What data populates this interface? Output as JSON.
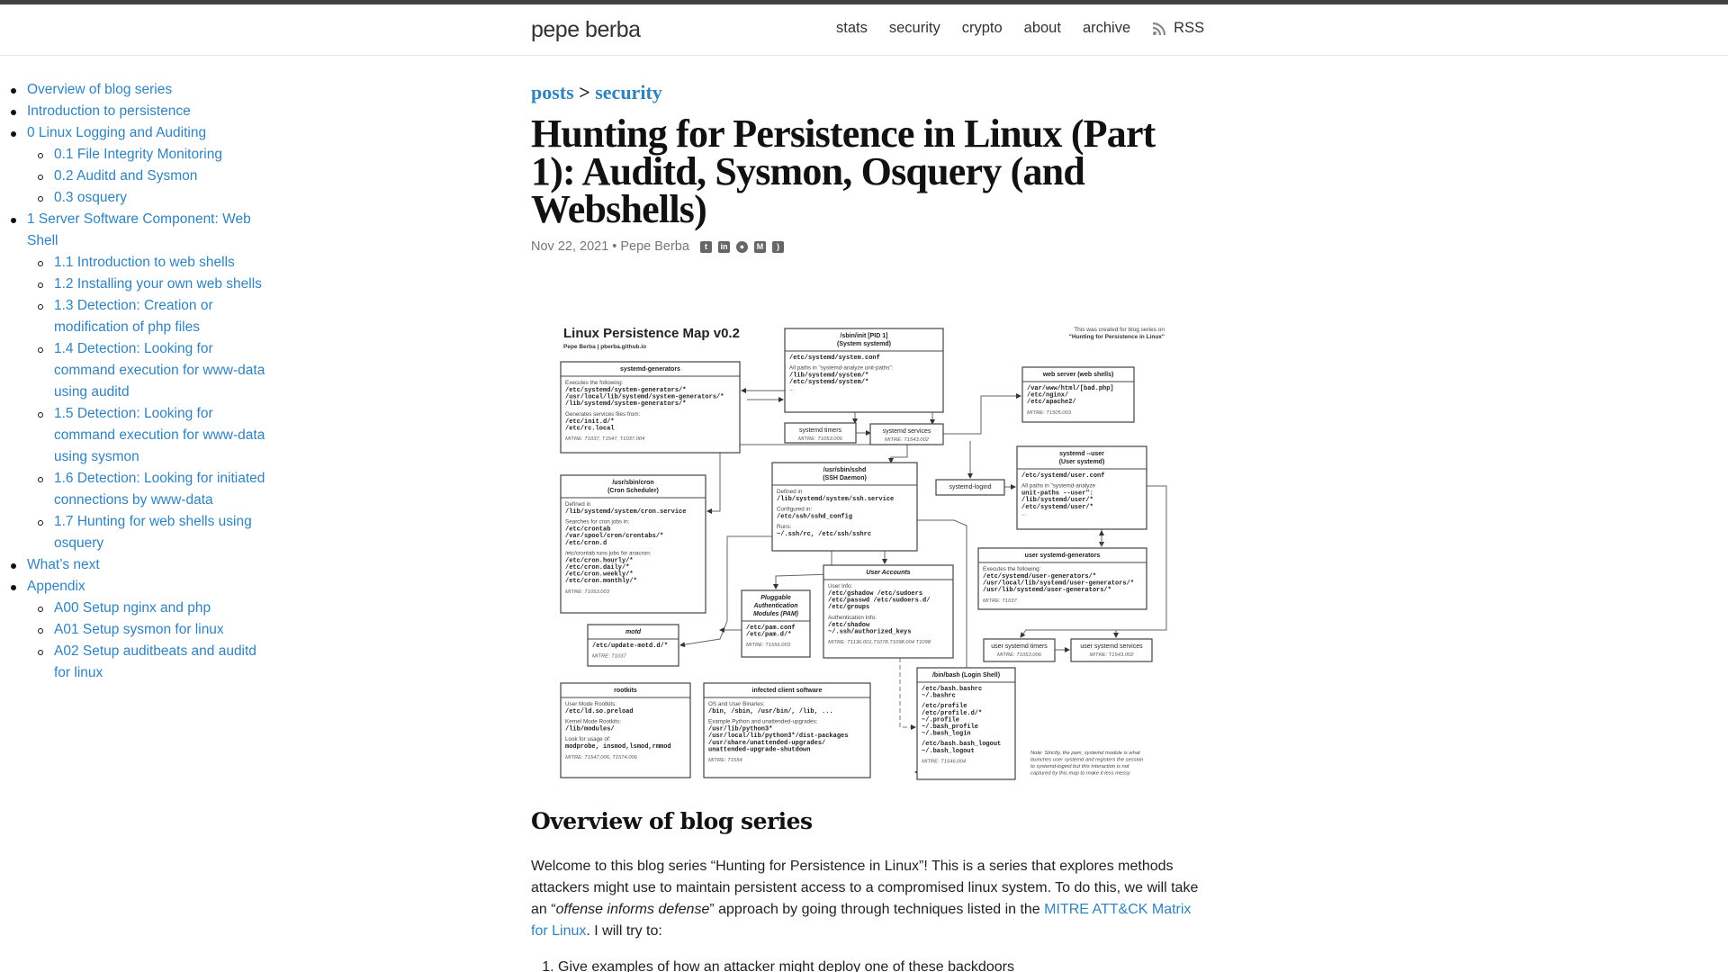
{
  "header": {
    "site_title": "pepe berba",
    "nav": [
      "stats",
      "security",
      "crypto",
      "about",
      "archive"
    ],
    "rss_label": "RSS"
  },
  "toc": [
    {
      "label": "Overview of blog series",
      "level": 0
    },
    {
      "label": "Introduction to persistence",
      "level": 0
    },
    {
      "label": "0 Linux Logging and Auditing",
      "level": 0
    },
    {
      "label": "0.1 File Integrity Monitoring",
      "level": 1
    },
    {
      "label": "0.2 Auditd and Sysmon",
      "level": 1
    },
    {
      "label": "0.3 osquery",
      "level": 1
    },
    {
      "label": "1 Server Software Component: Web Shell",
      "level": 0
    },
    {
      "label": "1.1 Introduction to web shells",
      "level": 1
    },
    {
      "label": "1.2 Installing your own web shells",
      "level": 1
    },
    {
      "label": "1.3 Detection: Creation or modification of php files",
      "level": 1
    },
    {
      "label": "1.4 Detection: Looking for command execution for www-data using auditd",
      "level": 1
    },
    {
      "label": "1.5 Detection: Looking for command execution for www-data using sysmon",
      "level": 1
    },
    {
      "label": "1.6 Detection: Looking for initiated connections by www-data",
      "level": 1
    },
    {
      "label": "1.7 Hunting for web shells using osquery",
      "level": 1
    },
    {
      "label": "What’s next",
      "level": 0
    },
    {
      "label": "Appendix",
      "level": 0
    },
    {
      "label": "A00 Setup nginx and php",
      "level": 1
    },
    {
      "label": "A01 Setup sysmon for linux",
      "level": 1
    },
    {
      "label": "A02 Setup auditbeats and auditd for linux",
      "level": 1
    }
  ],
  "post": {
    "breadcrumb": {
      "root": "posts",
      "sep": ">",
      "category": "security"
    },
    "title": "Hunting for Persistence in Linux (Part 1): Auditd, Sysmon, Osquery (and Webshells)",
    "date": "Nov 22, 2021",
    "dot": "•",
    "author": "Pepe Berba",
    "share_icons": [
      "twitter-icon",
      "linkedin-icon",
      "github-icon",
      "medium-icon",
      "rss-icon"
    ]
  },
  "diagram": {
    "title": "Linux Persistence Map v0.2",
    "subtitle": "Pepe Berba | pberba.github.io",
    "credit": [
      "This was created for blog series on",
      "\"Hunting for Persistence in Linux\""
    ],
    "note": [
      "Note: Strictly, the pam_systemd module is what",
      "launches user systemd and registers the session",
      "to systemd-logind but this interaction is not",
      "captured by this map to make it less messy"
    ],
    "boxes": [
      {
        "title": [
          "systemd-generators"
        ],
        "lines": [
          [
            "l",
            "Executes the following:"
          ],
          [
            "m",
            "/etc/systemd/system-generators/*"
          ],
          [
            "m",
            "/usr/local/lib/systemd/system-generators/*"
          ],
          [
            "m",
            "/lib/systemd/system-generators/*"
          ],
          [
            "g",
            ""
          ],
          [
            "l",
            "Generates services files from:"
          ],
          [
            "m",
            "/etc/init.d/*"
          ],
          [
            "m",
            "/etc/rc.local"
          ],
          [
            "g",
            ""
          ],
          [
            "i",
            "MITRE: T1037, T1547, T1037.004"
          ]
        ]
      },
      {
        "title": [
          "/sbin/init [PID 1]",
          "(System systemd)"
        ],
        "lines": [
          [
            "m",
            "/etc/systemd/system.conf"
          ],
          [
            "g",
            ""
          ],
          [
            "l",
            "All paths in \"systemd-analyze unit-paths\":"
          ],
          [
            "m",
            "/lib/systemd/system/*"
          ],
          [
            "m",
            "/etc/systemd/system/*"
          ],
          [
            "l",
            "..."
          ]
        ]
      },
      {
        "title": [
          "systemd timers"
        ],
        "plain": true,
        "lines": [
          [
            "i",
            "MITRE: T1053.006"
          ]
        ]
      },
      {
        "title": [
          "systemd services"
        ],
        "plain": true,
        "lines": [
          [
            "i",
            "MITRE: T1543.002"
          ]
        ]
      },
      {
        "title": [
          "web server (web shells)"
        ],
        "lines": [
          [
            "m",
            "/var/www/html/[bad.php]"
          ],
          [
            "m",
            "/etc/nginx/"
          ],
          [
            "m",
            "/etc/apache2/"
          ],
          [
            "g",
            ""
          ],
          [
            "i",
            "MITRE: T1505.003"
          ]
        ]
      },
      {
        "title": [
          "systemd --user",
          "(User systemd)"
        ],
        "lines": [
          [
            "m",
            "/etc/systemd/user.conf"
          ],
          [
            "g",
            ""
          ],
          [
            "l",
            "All paths in \"systemd-analyze"
          ],
          [
            "m",
            "unit-paths --user\":"
          ],
          [
            "m",
            "/lib/systemd/user/*"
          ],
          [
            "m",
            "/etc/systemd/user/*"
          ],
          [
            "l",
            "..."
          ]
        ]
      },
      {
        "title": [
          "systemd-logind"
        ],
        "plain": true,
        "lines": []
      },
      {
        "title": [
          "/usr/sbin/cron",
          "(Cron Scheduler)"
        ],
        "lines": [
          [
            "l",
            "Defined in"
          ],
          [
            "m",
            "/lib/systemd/system/cron.service"
          ],
          [
            "g",
            ""
          ],
          [
            "l",
            "Searches for cron jobs in:"
          ],
          [
            "m",
            "/etc/crontab"
          ],
          [
            "m",
            "/var/spool/cron/crontabs/*"
          ],
          [
            "m",
            "/etc/cron.d"
          ],
          [
            "g",
            ""
          ],
          [
            "l",
            "/etc/crontab runs jobs for anacron:"
          ],
          [
            "m",
            "/etc/cron.hourly/*"
          ],
          [
            "m",
            "/etc/cron.daily/*"
          ],
          [
            "m",
            "/etc/cron.weekly/*"
          ],
          [
            "m",
            "/etc/cron.monthly/*"
          ],
          [
            "g",
            ""
          ],
          [
            "i",
            "MITRE: T1053.003"
          ]
        ]
      },
      {
        "title": [
          "/usr/sbin/sshd",
          "(SSH Daemon)"
        ],
        "lines": [
          [
            "l",
            "Defined in"
          ],
          [
            "m",
            "/lib/systemd/system/ssh.service"
          ],
          [
            "g",
            ""
          ],
          [
            "l",
            "Configured in:"
          ],
          [
            "m",
            "/etc/ssh/sshd_config"
          ],
          [
            "g",
            ""
          ],
          [
            "l",
            "Runs:"
          ],
          [
            "m",
            "~/.ssh/rc, /etc/ssh/sshrc"
          ]
        ]
      },
      {
        "title": [
          "user systemd-generators"
        ],
        "lines": [
          [
            "l",
            "Executes the following:"
          ],
          [
            "m",
            "/etc/systemd/user-generators/*"
          ],
          [
            "m",
            "/usr/local/lib/systemd/user-generators/*"
          ],
          [
            "m",
            "/usr/lib/systemd/user-generators/*"
          ],
          [
            "g",
            ""
          ],
          [
            "i",
            "MITRE: T1037"
          ]
        ]
      },
      {
        "title": [
          "User Accounts"
        ],
        "italic": true,
        "lines": [
          [
            "l",
            "User Info:"
          ],
          [
            "m",
            "/etc/gshadow  /etc/sudoers"
          ],
          [
            "m",
            "/etc/passwd   /etc/sudoers.d/"
          ],
          [
            "m",
            "/etc/groups"
          ],
          [
            "g",
            ""
          ],
          [
            "l",
            "Authentication Info:"
          ],
          [
            "m",
            "/etc/shadow"
          ],
          [
            "m",
            "~/.ssh/authorized_keys"
          ],
          [
            "g",
            ""
          ],
          [
            "i",
            "MITRE: T1136.001,T1078,T1098.004 T1098"
          ]
        ]
      },
      {
        "title": [
          "Pluggable",
          "Authentication",
          "Modules (PAM)"
        ],
        "italic": true,
        "lines": [
          [
            "m",
            "/etc/pam.conf"
          ],
          [
            "m",
            "/etc/pam.d/*"
          ],
          [
            "g",
            ""
          ],
          [
            "i",
            "MITRE: T1556.003"
          ]
        ]
      },
      {
        "title": [
          "motd"
        ],
        "italic": true,
        "lines": [
          [
            "m",
            "/etc/update-motd.d/*"
          ],
          [
            "g",
            ""
          ],
          [
            "i",
            "MITRE: T1037"
          ]
        ]
      },
      {
        "title": [
          "user systemd timers"
        ],
        "plain": true,
        "lines": [
          [
            "i",
            "MITRE: T1053.006"
          ]
        ]
      },
      {
        "title": [
          "user systemd services"
        ],
        "plain": true,
        "lines": [
          [
            "i",
            "MITRE: T1543.002"
          ]
        ]
      },
      {
        "title": [
          "rootkits"
        ],
        "lines": [
          [
            "l",
            "User Mode Rootkits:"
          ],
          [
            "m",
            "/etc/ld.so.preload"
          ],
          [
            "g",
            ""
          ],
          [
            "l",
            "Kernel Mode Rootkits:"
          ],
          [
            "m",
            "/lib/modules/"
          ],
          [
            "g",
            ""
          ],
          [
            "l",
            "Look for usage of:"
          ],
          [
            "m",
            "modprobe, insmod,lsmod,rmmod"
          ],
          [
            "g",
            ""
          ],
          [
            "i",
            "MITRE: T1547.006, T1574.006"
          ]
        ]
      },
      {
        "title": [
          "infected client software"
        ],
        "lines": [
          [
            "l",
            "OS and User Binaries:"
          ],
          [
            "m",
            "/bin, /sbin, /usr/bin/, /lib, ..."
          ],
          [
            "g",
            ""
          ],
          [
            "l",
            "Example Python and unattended-upgrades:"
          ],
          [
            "m",
            "/usr/lib/python3*"
          ],
          [
            "m",
            "/usr/local/lib/python3*/dist-packages"
          ],
          [
            "m",
            "/usr/share/unattended-upgrades/"
          ],
          [
            "m",
            "unattended-upgrade-shutdown"
          ],
          [
            "g",
            ""
          ],
          [
            "i",
            "MITRE: T1554"
          ]
        ]
      },
      {
        "title": [
          "/bin/bash (Login Shell)"
        ],
        "lines": [
          [
            "m",
            "/etc/bash.bashrc"
          ],
          [
            "m",
            "~/.bashrc"
          ],
          [
            "g",
            ""
          ],
          [
            "m",
            "/etc/profile"
          ],
          [
            "m",
            "/etc/profile.d/*"
          ],
          [
            "m",
            "~/.profile"
          ],
          [
            "m",
            "~/.bash_profile"
          ],
          [
            "m",
            "~/.bash_login"
          ],
          [
            "g",
            ""
          ],
          [
            "m",
            "/etc/bash.bash_logout"
          ],
          [
            "m",
            "~/.bash_logout"
          ],
          [
            "g",
            ""
          ],
          [
            "i",
            "MITRE: T1546.004"
          ]
        ]
      }
    ]
  },
  "overview": {
    "heading": "Overview of blog series",
    "p1_a": "Welcome to this blog series “Hunting for Persistence in Linux”! This is a series that explores methods attackers might use to maintain persistent access to a compromised linux system. To do this, we will take an “",
    "p1_em": "offense informs defense",
    "p1_b": "” approach by going through techniques listed in the ",
    "p1_link": "MITRE ATT&CK Matrix for Linux",
    "p1_c": ". I will try to:",
    "list": [
      "Give examples of how an attacker might deploy one of these backdoors"
    ]
  }
}
